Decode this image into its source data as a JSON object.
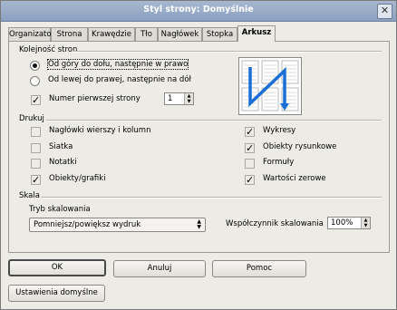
{
  "window": {
    "title": "Styl strony: Domyślnie"
  },
  "tabs": [
    {
      "label": "Organizator"
    },
    {
      "label": "Strona"
    },
    {
      "label": "Krawędzie"
    },
    {
      "label": "Tło"
    },
    {
      "label": "Nagłówek"
    },
    {
      "label": "Stopka"
    },
    {
      "label": "Arkusz"
    }
  ],
  "active_tab": "Arkusz",
  "page_order": {
    "heading": "Kolejność stron",
    "options": [
      {
        "label": "Od góry do dołu, następnie w prawo",
        "selected": true
      },
      {
        "label": "Od lewej do prawej, następnie na dół",
        "selected": false
      }
    ],
    "first_page": {
      "label": "Numer pierwszej strony",
      "checked": true,
      "value": "1"
    }
  },
  "print": {
    "heading": "Drukuj",
    "left": [
      {
        "label": "Nagłówki wierszy i kolumn",
        "checked": false
      },
      {
        "label": "Siatka",
        "checked": false
      },
      {
        "label": "Notatki",
        "checked": false
      },
      {
        "label": "Obiekty/grafiki",
        "checked": true
      }
    ],
    "right": [
      {
        "label": "Wykresy",
        "checked": true
      },
      {
        "label": "Obiekty rysunkowe",
        "checked": true
      },
      {
        "label": "Formuły",
        "checked": false
      },
      {
        "label": "Wartości zerowe",
        "checked": true
      }
    ]
  },
  "scale": {
    "heading": "Skala",
    "mode_label": "Tryb skalowania",
    "mode_value": "Pomniejsz/powiększ wydruk",
    "factor_label": "Współczynnik skalowania",
    "factor_value": "100%"
  },
  "buttons": {
    "ok": "OK",
    "cancel": "Anuluj",
    "help": "Pomoc",
    "defaults": "Ustawienia domyślne"
  },
  "colors": {
    "titlebar": "#94a8c6",
    "preview_arrow": "#1a6fd6"
  }
}
